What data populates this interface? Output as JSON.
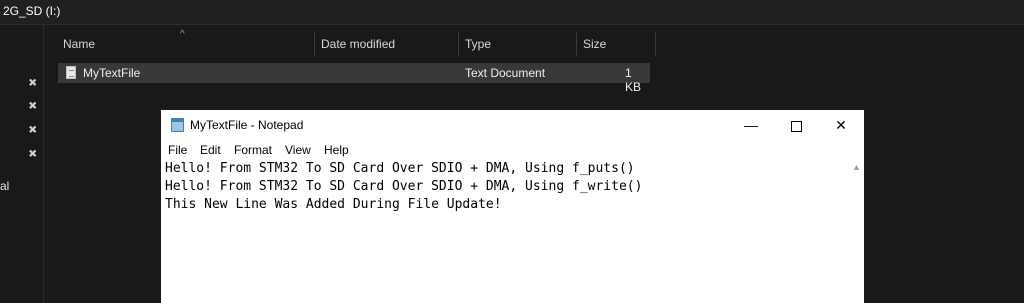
{
  "explorer": {
    "title": "2G_SD (I:)",
    "nav_partial": "al",
    "columns": {
      "name": "Name",
      "date": "Date modified",
      "type": "Type",
      "size": "Size"
    },
    "files": [
      {
        "name": "MyTextFile",
        "date": "",
        "type": "Text Document",
        "size": "1 KB"
      }
    ],
    "icons": [
      "pin-icon",
      "document-icon",
      "sort-up-icon"
    ]
  },
  "notepad": {
    "title": "MyTextFile - Notepad",
    "controls": {
      "minimize": "—",
      "close": "✕"
    },
    "menu": [
      "File",
      "Edit",
      "Format",
      "View",
      "Help"
    ],
    "lines": [
      "Hello! From STM32 To SD Card Over SDIO + DMA, Using f_puts()",
      "Hello! From STM32 To SD Card Over SDIO + DMA, Using f_write()",
      "This New Line Was Added During File Update!"
    ],
    "icons": [
      "notepad-icon",
      "minimize-icon",
      "maximize-icon",
      "close-icon",
      "scroll-up-icon"
    ]
  },
  "colors": {
    "explorer_bg": "#191919",
    "selected_row": "#383838",
    "notepad_bg": "#ffffff"
  }
}
